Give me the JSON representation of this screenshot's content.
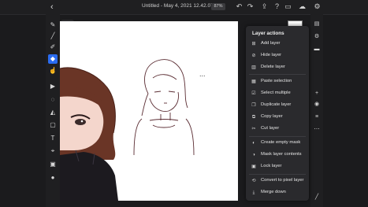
{
  "header": {
    "title": "Untitled - May 4, 2021 12.42.07",
    "zoom": "87%"
  },
  "layer_menu": {
    "title": "Layer actions",
    "items": [
      {
        "label": "Add layer",
        "icon": "plus-square-icon"
      },
      {
        "label": "Hide layer",
        "icon": "eye-off-icon"
      },
      {
        "label": "Delete layer",
        "icon": "trash-icon"
      },
      {
        "label": "Paste selection",
        "icon": "paste-icon"
      },
      {
        "label": "Select multiple",
        "icon": "select-multiple-icon"
      },
      {
        "label": "Duplicate layer",
        "icon": "duplicate-icon"
      },
      {
        "label": "Copy layer",
        "icon": "copy-icon"
      },
      {
        "label": "Cut layer",
        "icon": "scissors-icon"
      },
      {
        "label": "Create empty mask",
        "icon": "mask-icon"
      },
      {
        "label": "Mask layer contents",
        "icon": "mask-contents-icon"
      },
      {
        "label": "Lock layer",
        "icon": "lock-icon"
      },
      {
        "label": "Convert to pixel layer",
        "icon": "convert-icon"
      },
      {
        "label": "Merge down",
        "icon": "merge-down-icon"
      }
    ]
  },
  "colors": {
    "accent": "#2b6cf0",
    "panel": "#2a2a2d",
    "canvas": "#ffffff",
    "hair": "#6a3526",
    "sweater": "#1c1a1f"
  }
}
